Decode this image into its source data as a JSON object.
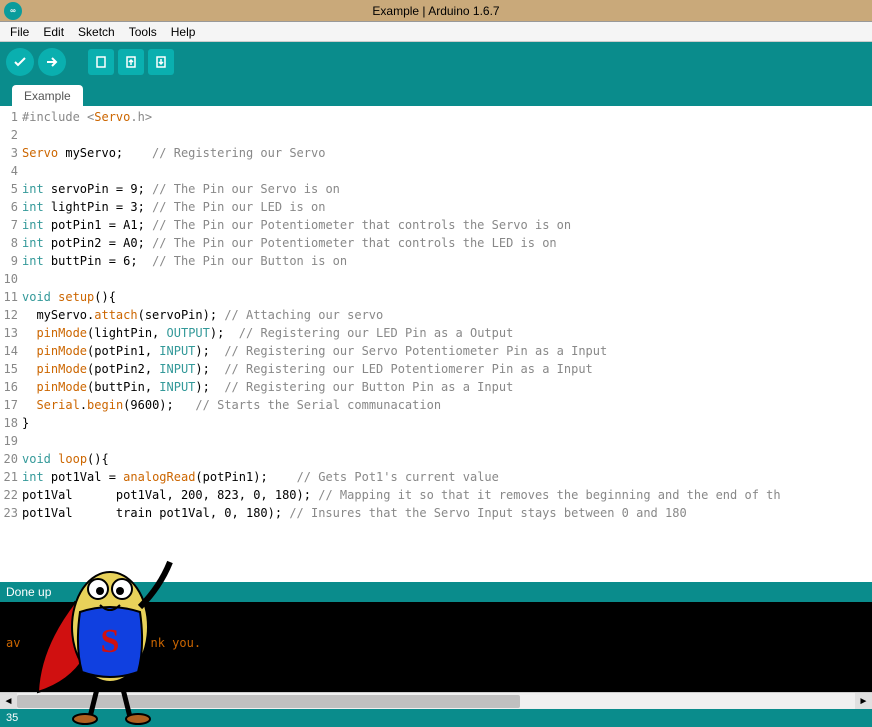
{
  "window": {
    "title": "Example | Arduino 1.6.7"
  },
  "menu": {
    "file": "File",
    "edit": "Edit",
    "sketch": "Sketch",
    "tools": "Tools",
    "help": "Help"
  },
  "tab": {
    "name": "Example"
  },
  "status": {
    "text": "Done up"
  },
  "footer": {
    "line": "35"
  },
  "console": {
    "l1": "                                        ",
    "l2": "av                  nk you.",
    "l3": ""
  },
  "code": {
    "lines": [
      {
        "n": 1,
        "html": "<span class='cm'>#include &lt;</span><span class='ident'>Servo</span><span class='cm'>.h&gt;</span>"
      },
      {
        "n": 2,
        "html": ""
      },
      {
        "n": 3,
        "html": "<span class='ident'>Servo</span> myServo;    <span class='cm'>// Registering our Servo</span>"
      },
      {
        "n": 4,
        "html": ""
      },
      {
        "n": 5,
        "html": "<span class='type'>int</span> servoPin = 9; <span class='cm'>// The Pin our Servo is on</span>"
      },
      {
        "n": 6,
        "html": "<span class='type'>int</span> lightPin = 3; <span class='cm'>// The Pin our LED is on</span>"
      },
      {
        "n": 7,
        "html": "<span class='type'>int</span> potPin1 = A1; <span class='cm'>// The Pin our Potentiometer that controls the Servo is on</span>"
      },
      {
        "n": 8,
        "html": "<span class='type'>int</span> potPin2 = A0; <span class='cm'>// The Pin our Potentiometer that controls the LED is on</span>"
      },
      {
        "n": 9,
        "html": "<span class='type'>int</span> buttPin = 6;  <span class='cm'>// The Pin our Button is on</span>"
      },
      {
        "n": 10,
        "html": ""
      },
      {
        "n": 11,
        "html": "<span class='type'>void</span> <span class='ident'>setup</span>(){"
      },
      {
        "n": 12,
        "html": "  myServo.<span class='ident'>attach</span>(servoPin); <span class='cm'>// Attaching our servo</span>"
      },
      {
        "n": 13,
        "html": "  <span class='ident'>pinMode</span>(lightPin, <span class='const-kw'>OUTPUT</span>);  <span class='cm'>// Registering our LED Pin as a Output</span>"
      },
      {
        "n": 14,
        "html": "  <span class='ident'>pinMode</span>(potPin1, <span class='const-kw'>INPUT</span>);  <span class='cm'>// Registering our Servo Potentiometer Pin as a Input</span>"
      },
      {
        "n": 15,
        "html": "  <span class='ident'>pinMode</span>(potPin2, <span class='const-kw'>INPUT</span>);  <span class='cm'>// Registering our LED Potentiomerer Pin as a Input</span>"
      },
      {
        "n": 16,
        "html": "  <span class='ident'>pinMode</span>(buttPin, <span class='const-kw'>INPUT</span>);  <span class='cm'>// Registering our Button Pin as a Input</span>"
      },
      {
        "n": 17,
        "html": "  <span class='ident'>Serial</span>.<span class='ident'>begin</span>(9600);   <span class='cm'>// Starts the Serial communacation</span>"
      },
      {
        "n": 18,
        "html": "}"
      },
      {
        "n": 19,
        "html": ""
      },
      {
        "n": 20,
        "html": "<span class='type'>void</span> <span class='ident'>loop</span>(){"
      },
      {
        "n": 21,
        "html": "<span class='type'>int</span> pot1Val = <span class='ident'>analogRead</span>(potPin1);    <span class='cm'>// Gets Pot1's current value</span>"
      },
      {
        "n": 22,
        "html": "pot1Val      pot1Val, 200, 823, 0, 180); <span class='cm'>// Mapping it so that it removes the beginning and the end of th</span>"
      },
      {
        "n": 23,
        "html": "pot1Val      train pot1Val, 0, 180); <span class='cm'>// Insures that the Servo Input stays between 0 and 180</span>"
      }
    ]
  }
}
